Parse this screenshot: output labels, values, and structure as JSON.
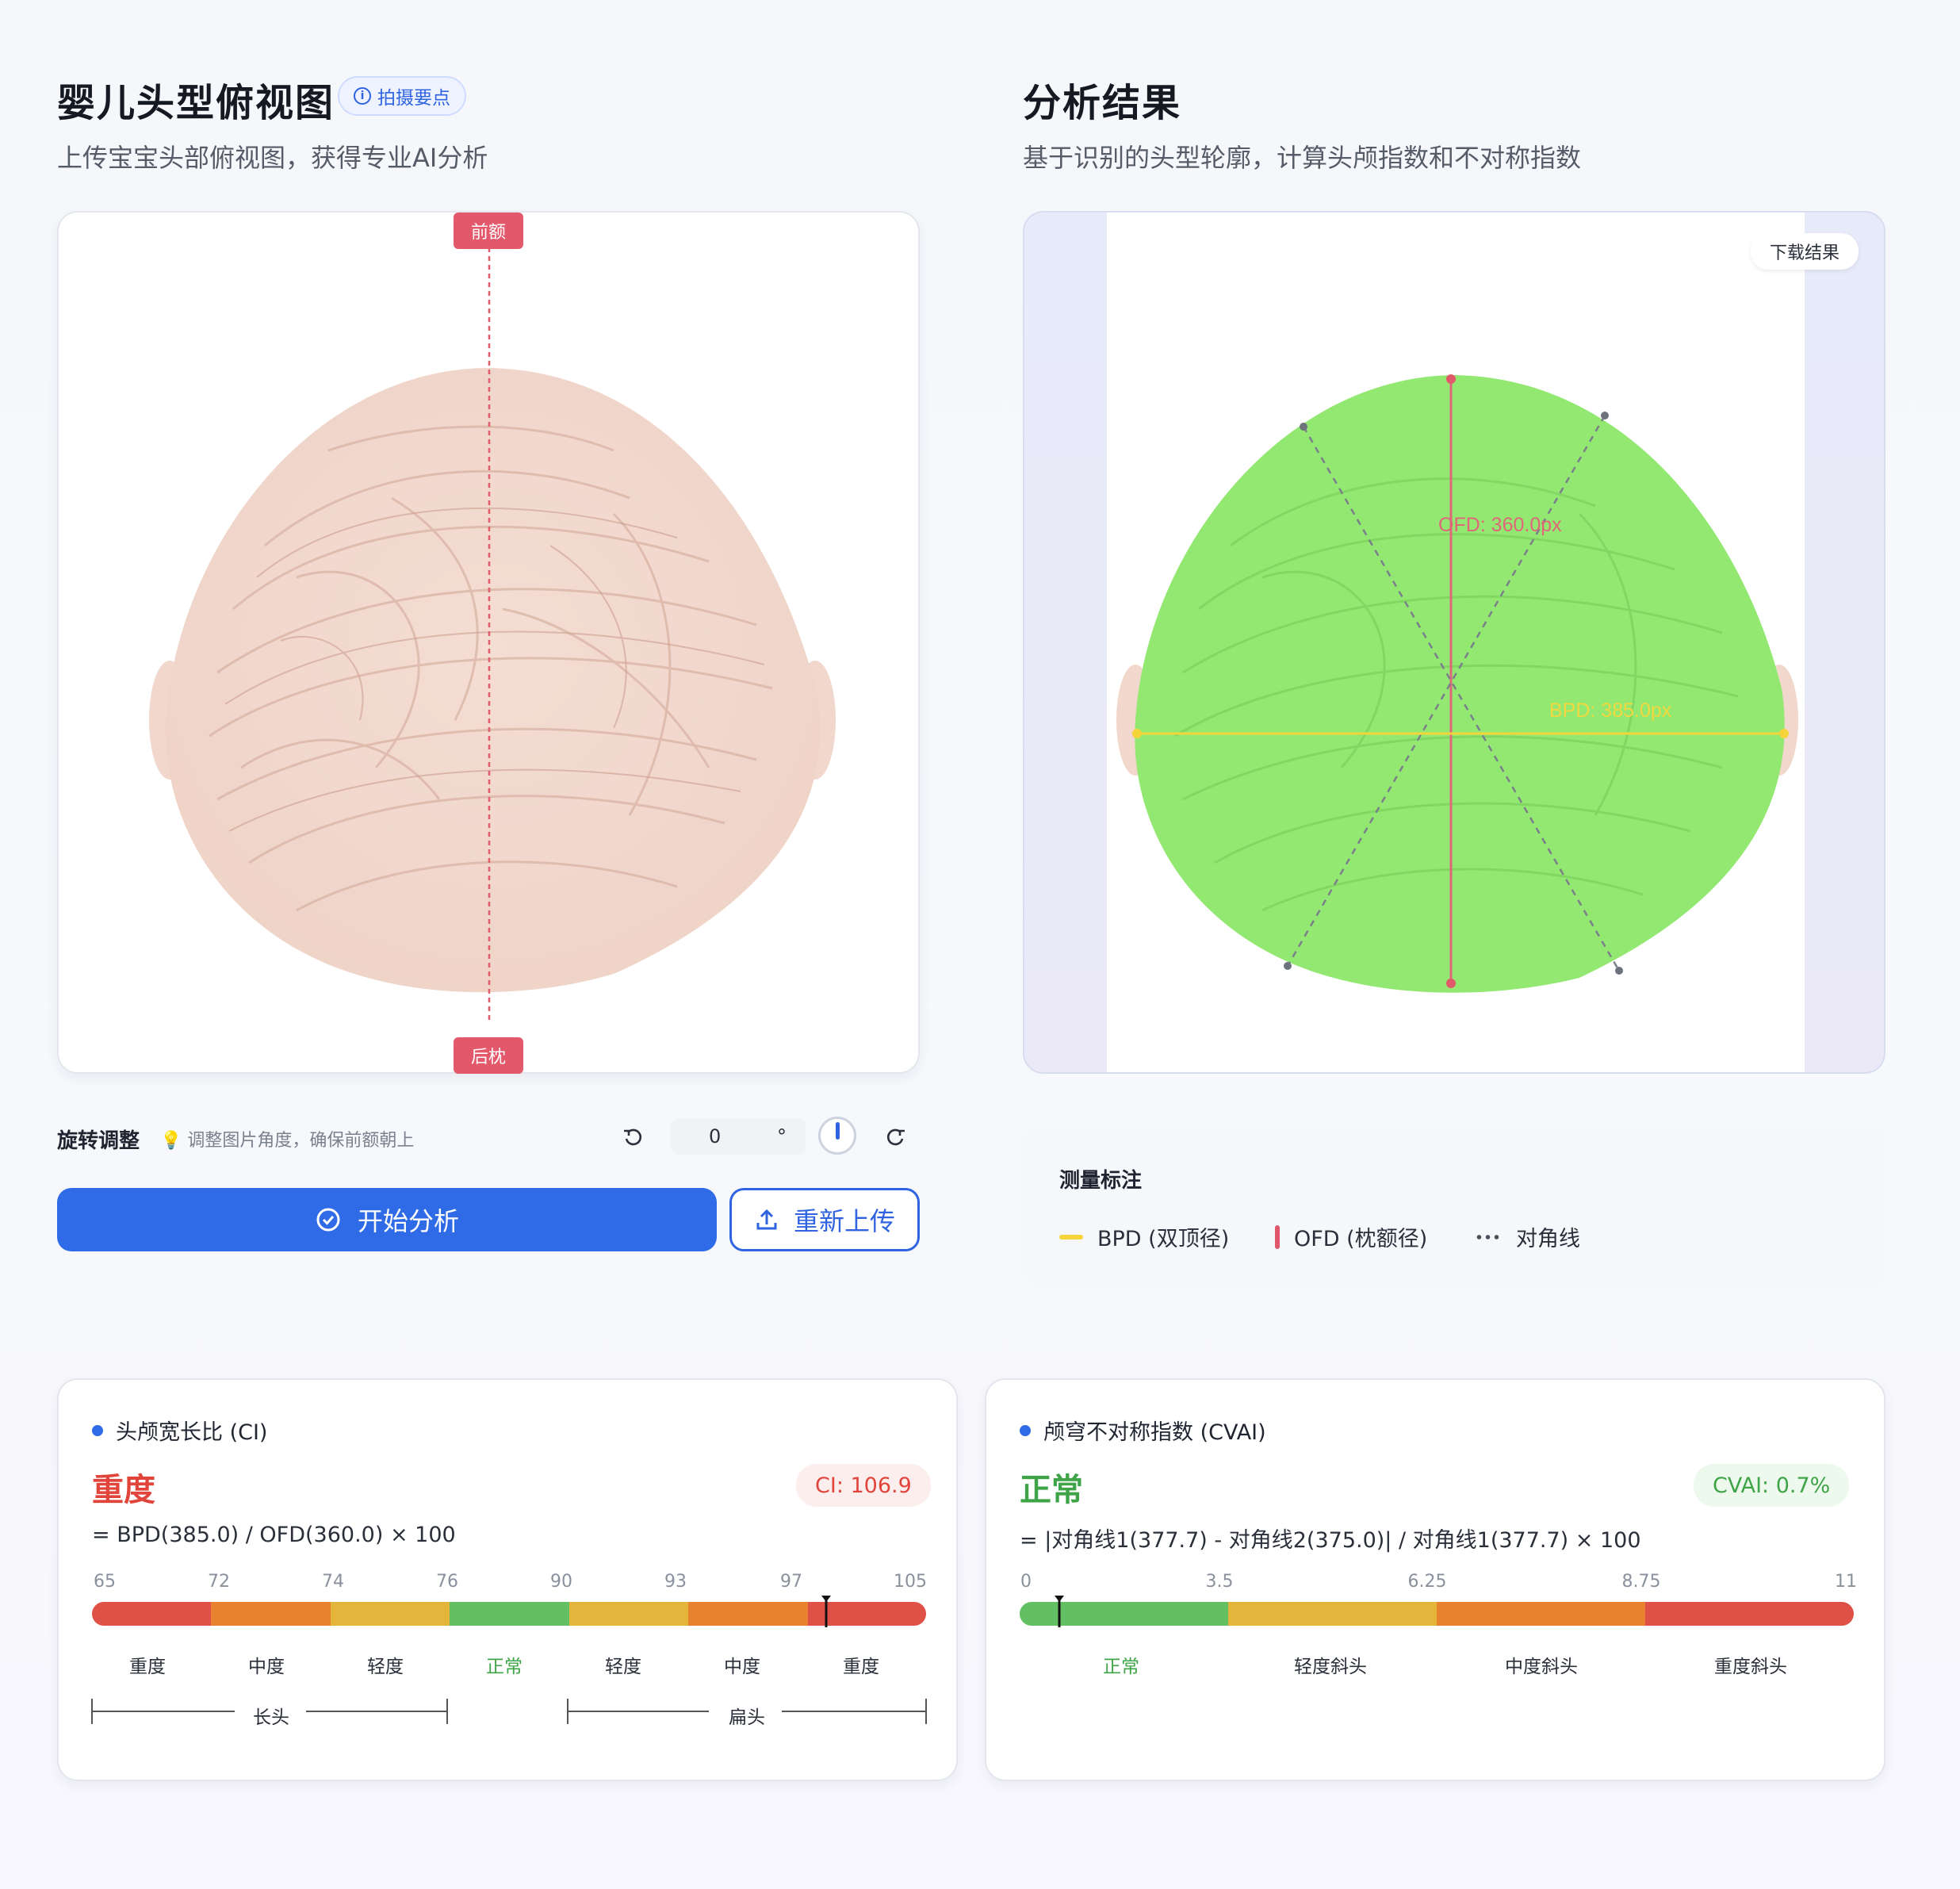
{
  "left": {
    "title": "婴儿头型俯视图",
    "tip_label": "拍摄要点",
    "subtitle": "上传宝宝头部俯视图，获得专业AI分析",
    "marker_top": "前额",
    "marker_bottom": "后枕",
    "rotation": {
      "label": "旋转调整",
      "hint": "调整图片角度，确保前额朝上",
      "value": "0",
      "unit": "°"
    },
    "start_button": "开始分析",
    "reupload_button": "重新上传"
  },
  "right": {
    "title": "分析结果",
    "subtitle": "基于识别的头型轮廓，计算头颅指数和不对称指数",
    "download_button": "下载结果",
    "ofd_label": "OFD: 360.0px",
    "bpd_label": "BPD: 385.0px",
    "legend": {
      "title": "测量标注",
      "items": [
        "BPD (双顶径)",
        "OFD (枕额径)",
        "对角线"
      ]
    }
  },
  "ci_card": {
    "title": "头颅宽长比 (CI)",
    "status": "重度",
    "value_pill": "CI: 106.9",
    "formula": "= BPD(385.0) / OFD(360.0) × 100",
    "ticks": [
      "65",
      "72",
      "74",
      "76",
      "90",
      "93",
      "97",
      "105"
    ],
    "segments": [
      "重度",
      "中度",
      "轻度",
      "正常",
      "轻度",
      "中度",
      "重度"
    ],
    "brackets": [
      "长头",
      "扁头"
    ]
  },
  "cvai_card": {
    "title": "颅穹不对称指数 (CVAI)",
    "status": "正常",
    "value_pill": "CVAI: 0.7%",
    "formula": "= |对角线1(377.7) - 对角线2(375.0)| / 对角线1(377.7) × 100",
    "ticks": [
      "0",
      "3.5",
      "6.25",
      "8.75",
      "11"
    ],
    "segments": [
      "正常",
      "轻度斜头",
      "中度斜头",
      "重度斜头"
    ]
  },
  "colors": {
    "severe": "#df5146",
    "moderate": "#e8822f",
    "mild": "#e3b53a",
    "normal": "#62c062",
    "primary": "#2f6be6"
  }
}
